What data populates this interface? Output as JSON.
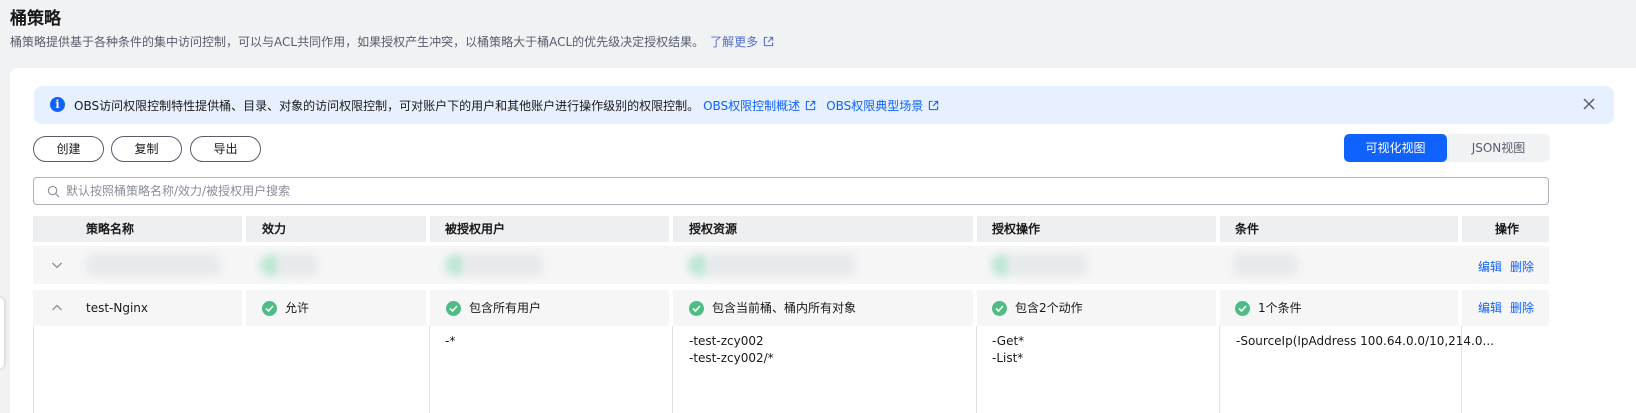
{
  "header": {
    "title": "桶策略",
    "description": "桶策略提供基于各种条件的集中访问控制，可以与ACL共同作用，如果授权产生冲突，以桶策略大于桶ACL的优先级决定授权结果。",
    "learn_more": "了解更多"
  },
  "notice": {
    "text": "OBS访问权限控制特性提供桶、目录、对象的访问权限控制，可对账户下的用户和其他账户进行操作级别的权限控制。",
    "link1": "OBS权限控制概述",
    "link2": "OBS权限典型场景"
  },
  "toolbar": {
    "create": "创建",
    "copy": "复制",
    "export": "导出",
    "view_visual": "可视化视图",
    "view_json": "JSON视图"
  },
  "search": {
    "placeholder": "默认按照桶策略名称/效力/被授权用户搜索"
  },
  "table": {
    "headers": {
      "name": "策略名称",
      "effect": "效力",
      "principal": "被授权用户",
      "resource": "授权资源",
      "action": "授权操作",
      "condition": "条件",
      "ops": "操作"
    },
    "row_actions": {
      "edit": "编辑",
      "delete": "删除"
    },
    "expanded_row": {
      "name": "test-Nginx",
      "effect": "允许",
      "principal": "包含所有用户",
      "resource": "包含当前桶、桶内所有对象",
      "action": "包含2个动作",
      "condition": "1个条件",
      "detail": {
        "principal": [
          "-*"
        ],
        "resource": [
          "-test-zcy002",
          "-test-zcy002/*"
        ],
        "action": [
          "-Get*",
          "-List*"
        ],
        "condition": [
          "-SourceIp(IpAddress 100.64.0.0/10,214.0..."
        ]
      }
    }
  },
  "colors": {
    "primary": "#0f62fe",
    "success": "#4ebc85",
    "notice_bg": "#e6f0ff"
  }
}
